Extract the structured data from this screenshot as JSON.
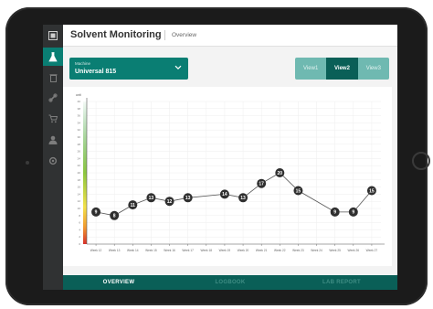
{
  "header": {
    "title": "Solvent Monitoring",
    "breadcrumb": "Overview"
  },
  "sidebar": {
    "items": [
      {
        "icon": "app-logo-icon",
        "active": false
      },
      {
        "icon": "flask-icon",
        "active": true
      },
      {
        "icon": "trash-icon",
        "active": false
      },
      {
        "icon": "link-icon",
        "active": false
      },
      {
        "icon": "cart-icon",
        "active": false
      },
      {
        "icon": "user-icon",
        "active": false
      },
      {
        "icon": "settings-icon",
        "active": false
      }
    ]
  },
  "machine_select": {
    "label": "Machine",
    "value": "Universal 815"
  },
  "view_toggle": {
    "options": [
      "View1",
      "View2",
      "View3"
    ],
    "selected": "View2"
  },
  "bottom_nav": {
    "tabs": [
      "OVERVIEW",
      "LOGBOOK",
      "LAB REPORT"
    ],
    "active": "OVERVIEW"
  },
  "colors": {
    "brand": "#0a7e73",
    "brand_dark": "#0a5f57",
    "gradient": [
      "#d7312c",
      "#f19a2f",
      "#f3e14a",
      "#8cc63f",
      "#2e9e47"
    ]
  },
  "chart_data": {
    "type": "line",
    "ylabel": "unit",
    "ylim": [
      0,
      40
    ],
    "yticks": [
      0,
      2,
      4,
      6,
      8,
      10,
      12,
      14,
      16,
      18,
      20,
      22,
      24,
      26,
      28,
      30,
      32,
      34,
      36,
      38,
      40
    ],
    "x": [
      "Week 12",
      "Week 13",
      "Week 14",
      "Week 15",
      "Week 16",
      "Week 17",
      "Week 18",
      "Week 19",
      "Week 20",
      "Week 21",
      "Week 22",
      "Week 23",
      "Week 24",
      "Week 25",
      "Week 26",
      "Week 27"
    ],
    "values": [
      9,
      8,
      11,
      13,
      12,
      13,
      null,
      14,
      13,
      17,
      20,
      15,
      null,
      9,
      9,
      15
    ],
    "grid": true
  }
}
